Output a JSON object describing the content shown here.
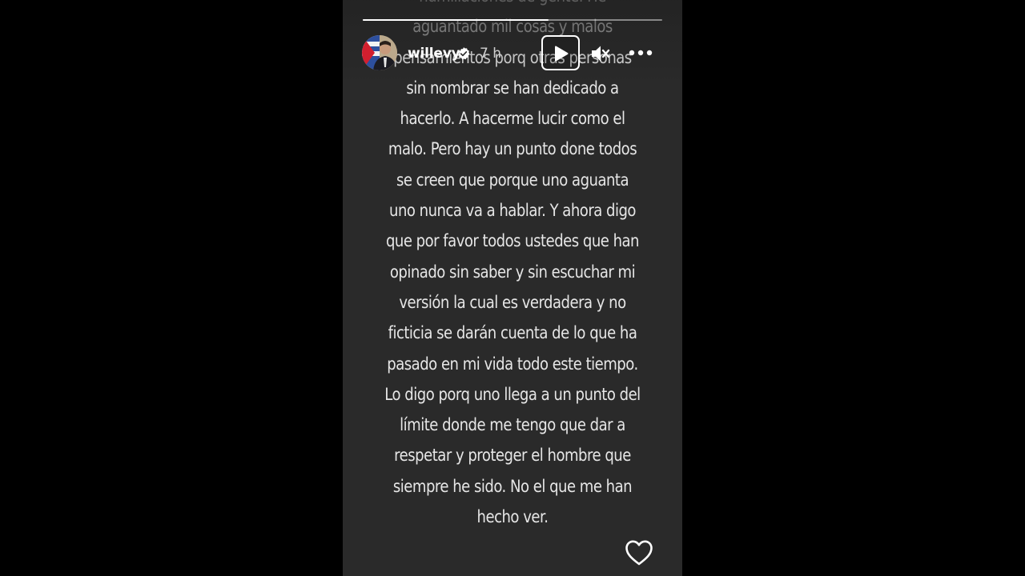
{
  "story": {
    "username": "willevy",
    "time_ago": "7 h",
    "progress": 0.62,
    "text_lines": [
      "humillaciones de gente. He",
      "aguantado mil cosas y malos",
      "pensamientos porq otras personas",
      "sin nombrar se han dedicado a",
      "hacerlo. A hacerme lucir como el",
      "malo. Pero hay un punto done todos",
      "se creen que porque uno aguanta",
      "uno nunca va a hablar. Y ahora digo",
      "que por favor todos ustedes que han",
      "opinado sin saber y sin escuchar mi",
      "versión la cual es verdadera y no",
      "ficticia se darán cuenta de lo que ha",
      "pasado en mi vida todo este tiempo.",
      "Lo digo porq uno llega a un punto del",
      "límite donde me tengo que dar a",
      "respetar y proteger el hombre que",
      "siempre he sido. No el que me han",
      "hecho ver."
    ]
  },
  "controls": {
    "play_icon": "play-icon",
    "mute_icon": "speaker-muted-icon",
    "more_icon": "more-horizontal-icon",
    "like_icon": "heart-icon",
    "verified_icon": "verified-badge-icon"
  },
  "colors": {
    "page_background": "#000000",
    "story_background": "#2a2a2a",
    "text": "#e6e6e6",
    "verified_badge": "#ffffff"
  }
}
